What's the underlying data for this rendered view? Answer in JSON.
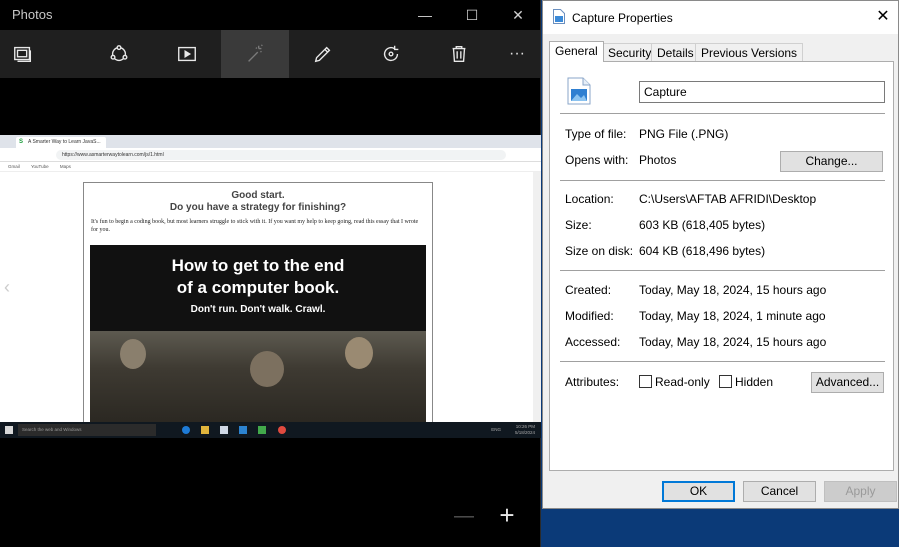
{
  "photos": {
    "app_title": "Photos",
    "window_controls": {
      "minimize": "—",
      "maximize": "☐",
      "close": "✕"
    },
    "toolbar": [
      {
        "name": "slideshow-icon"
      },
      {
        "name": "share-icon"
      },
      {
        "name": "video-icon"
      },
      {
        "name": "enhance-icon",
        "active": true
      },
      {
        "name": "edit-icon"
      },
      {
        "name": "rotate-icon"
      },
      {
        "name": "delete-icon"
      },
      {
        "name": "more-icon",
        "label": "···"
      }
    ],
    "nav": {
      "previous": "‹"
    },
    "zoom": {
      "out": "—",
      "in": "+"
    },
    "image": {
      "tab_title": "A Smarter Way to Learn JavaS...",
      "url": "https://www.asmarterwaytolearn.com/js/1.html",
      "bookmarks": [
        "Gmail",
        "YouTube",
        "Maps"
      ],
      "heading1": "Good start.",
      "heading2": "Do you have a strategy for finishing?",
      "paragraph": "It's fun to begin a coding book, but most learners struggle to stick with it. If you want my help to keep going, read this essay that I wrote for you.",
      "banner_line1": "How to get to the end",
      "banner_line2": "of a computer book.",
      "banner_line3": "Don't run. Don't walk. Crawl.",
      "taskbar_search": "Search the web and Windows",
      "tray_time": "10:26 PM",
      "tray_date": "5/18/2024",
      "tray_lang": "ENG"
    }
  },
  "dialog": {
    "title": "Capture Properties",
    "close": "✕",
    "tabs": [
      "General",
      "Security",
      "Details",
      "Previous Versions"
    ],
    "file_name": "Capture",
    "type_label": "Type of file:",
    "type_value": "PNG File (.PNG)",
    "opens_label": "Opens with:",
    "opens_value": "Photos",
    "change_button": "Change...",
    "location_label": "Location:",
    "location_value": "C:\\Users\\AFTAB AFRIDI\\Desktop",
    "size_label": "Size:",
    "size_value": "603 KB (618,405 bytes)",
    "size_disk_label": "Size on disk:",
    "size_disk_value": "604 KB (618,496 bytes)",
    "created_label": "Created:",
    "created_value": "Today, May 18, 2024, 15 hours ago",
    "modified_label": "Modified:",
    "modified_value": "Today, May 18, 2024, 1 minute ago",
    "accessed_label": "Accessed:",
    "accessed_value": "Today, May 18, 2024, 15 hours ago",
    "attributes_label": "Attributes:",
    "readonly_label": "Read-only",
    "hidden_label": "Hidden",
    "advanced_button": "Advanced...",
    "ok_button": "OK",
    "cancel_button": "Cancel",
    "apply_button": "Apply"
  }
}
